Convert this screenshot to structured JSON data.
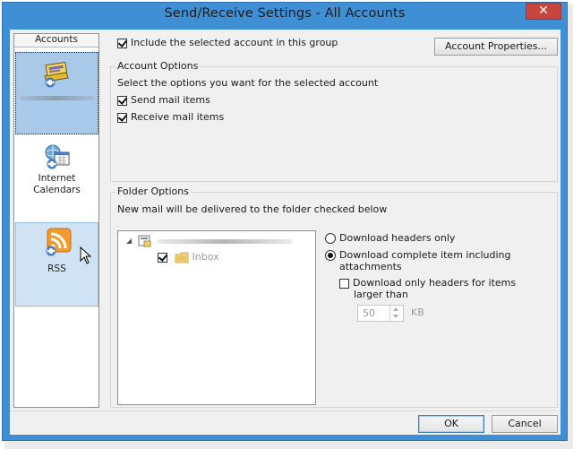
{
  "window": {
    "title": "Send/Receive Settings - All Accounts",
    "close_glyph": "✕"
  },
  "accounts": {
    "header": "Accounts",
    "items": [
      {
        "label": "",
        "icon": "mail-account-icon",
        "selected": true
      },
      {
        "label_line1": "Internet",
        "label_line2": "Calendars",
        "icon": "internet-calendar-icon"
      },
      {
        "label": "RSS",
        "icon": "rss-icon"
      }
    ]
  },
  "main": {
    "include_label": "Include the selected account in this group",
    "include_checked": true,
    "account_properties_label": "Account Properties...",
    "account_options": {
      "title": "Account Options",
      "description": "Select the options you want for the selected account",
      "send_label": "Send mail items",
      "send_checked": true,
      "receive_label": "Receive mail items",
      "receive_checked": true
    },
    "folder_options": {
      "title": "Folder Options",
      "description": "New mail will be delivered to the folder checked below",
      "tree": {
        "expand_glyph": "◢",
        "inbox_label": "Inbox",
        "inbox_checked": true
      },
      "download_headers_label": "Download headers only",
      "download_complete_label_line1": "Download complete item including",
      "download_complete_label_line2": "attachments",
      "selected_download": "complete",
      "headers_for_large_label_line1": "Download only headers for items",
      "headers_for_large_label_line2": "larger than",
      "headers_for_large_checked": false,
      "size_value": "50",
      "size_unit": "KB"
    }
  },
  "footer": {
    "ok_label": "OK",
    "cancel_label": "Cancel"
  },
  "colors": {
    "title_bar": "#3f8fd4",
    "close_button": "#c7463d",
    "selection": "#a9c9e8",
    "hover": "#cfe3f5"
  }
}
